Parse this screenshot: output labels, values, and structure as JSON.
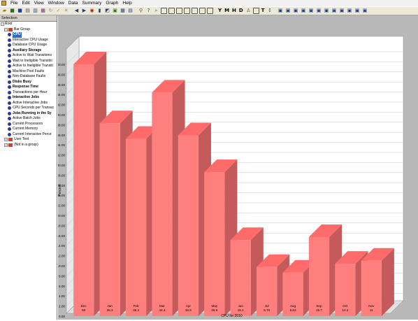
{
  "menubar": {
    "items": [
      "File",
      "Edit",
      "View",
      "Window",
      "Data",
      "Summary",
      "Graph",
      "Help"
    ]
  },
  "toolbar": {
    "text_buttons": [
      "Y",
      "M",
      "H",
      "D",
      "T"
    ]
  },
  "selection_panel": {
    "title": "Selection",
    "tree": [
      {
        "label": "Root",
        "level": 0,
        "kind": "root"
      },
      {
        "label": "Bar Group",
        "level": 1,
        "kind": "folder"
      },
      {
        "label": "CPU",
        "level": 2,
        "kind": "item",
        "bold": true,
        "selected": true
      },
      {
        "label": "Interactive CPU Usage",
        "level": 2,
        "kind": "item"
      },
      {
        "label": "Database CPU Usage",
        "level": 2,
        "kind": "item"
      },
      {
        "label": "Auxiliary Storage",
        "level": 2,
        "kind": "item",
        "bold": true
      },
      {
        "label": "Active to Wait Transitions",
        "level": 2,
        "kind": "item"
      },
      {
        "label": "Wait to Ineligible Transitio",
        "level": 2,
        "kind": "item"
      },
      {
        "label": "Active to Ineligible Transiti",
        "level": 2,
        "kind": "item"
      },
      {
        "label": "Machine Pool Faults",
        "level": 2,
        "kind": "item"
      },
      {
        "label": "Non-Database Faults",
        "level": 2,
        "kind": "item"
      },
      {
        "label": "Disks Busy",
        "level": 2,
        "kind": "item",
        "bold": true
      },
      {
        "label": "Response Time",
        "level": 2,
        "kind": "item",
        "bold": true
      },
      {
        "label": "Transactions per Hour",
        "level": 2,
        "kind": "item"
      },
      {
        "label": "Interactive Jobs",
        "level": 2,
        "kind": "item",
        "bold": true
      },
      {
        "label": "Active Interactive Jobs",
        "level": 2,
        "kind": "item"
      },
      {
        "label": "CPU Seconds per Transac",
        "level": 2,
        "kind": "item"
      },
      {
        "label": "Jobs Running in the Sy",
        "level": 2,
        "kind": "item",
        "bold": true
      },
      {
        "label": "Active Batch Jobs",
        "level": 2,
        "kind": "item"
      },
      {
        "label": "Current Processors",
        "level": 2,
        "kind": "item"
      },
      {
        "label": "Current Memory",
        "level": 2,
        "kind": "item"
      },
      {
        "label": "Current Interactive Perce",
        "level": 2,
        "kind": "item"
      },
      {
        "label": "User Text",
        "level": 1,
        "kind": "folder"
      },
      {
        "label": "(Not in a group)",
        "level": 1,
        "kind": "folder"
      }
    ]
  },
  "colors": {
    "bar_front": "#ff7f7f",
    "bar_top": "#ff6a6a",
    "bar_side": "#c45a5a",
    "plot_bg": "#ffffff",
    "grid": "#c8c8c8",
    "frame": "#b8b8b8"
  },
  "chart_data": {
    "type": "bar",
    "categories": [
      "Dec",
      "Jan",
      "Feb",
      "Mar",
      "Apr",
      "May",
      "Jun",
      "Jul",
      "Aug",
      "Sep",
      "Oct",
      "Nov"
    ],
    "value_labels": [
      "50",
      "38.3",
      "35.2",
      "44.4",
      "35.9",
      "28.6",
      "15.1",
      "9.76",
      "8.63",
      "15.7",
      "10.4",
      "11"
    ],
    "values": [
      50,
      38.3,
      35.2,
      44.4,
      35.9,
      28.6,
      15.1,
      9.76,
      8.63,
      15.7,
      10.4,
      11
    ],
    "ylim": [
      0,
      50
    ],
    "ytick_labels": [
      "0.00",
      "2.00",
      "4.00",
      "6.00",
      "8.00",
      "10.00",
      "12.00",
      "14.00",
      "16.00",
      "18.00",
      "20.00",
      "22.00",
      "24.00",
      "26.00",
      "28.00",
      "30.00",
      "32.00",
      "34.00",
      "36.00",
      "38.00",
      "40.00",
      "42.00",
      "44.00",
      "46.00",
      "48.00",
      "50.00"
    ],
    "ylabel": "Percent",
    "xlabel": "CPU for 2010",
    "grid": true,
    "style": "3d"
  }
}
